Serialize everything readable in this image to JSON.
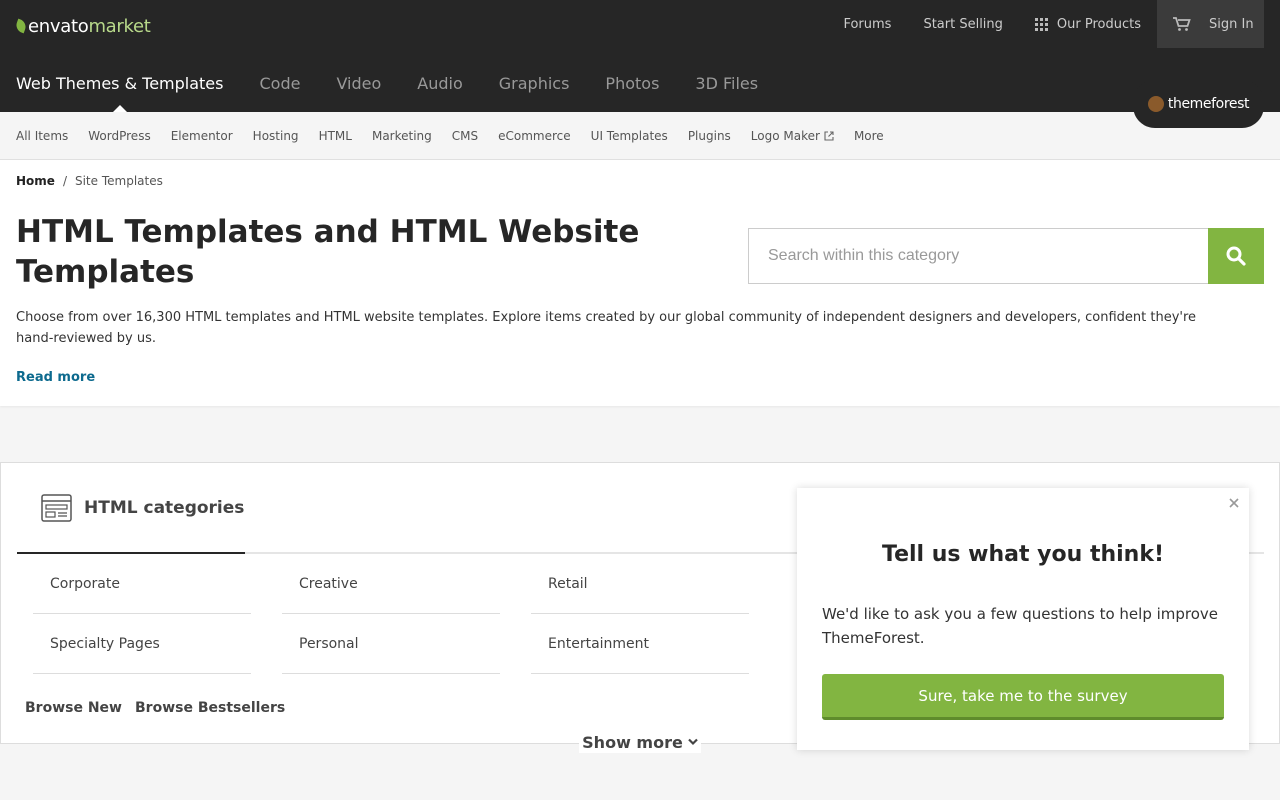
{
  "header": {
    "logo": {
      "text_main": "envato",
      "text_sub": "market"
    },
    "top_links": {
      "forums": "Forums",
      "start_selling": "Start Selling",
      "our_products": "Our Products",
      "sign_in": "Sign In"
    },
    "categories": [
      {
        "label": "Web Themes & Templates",
        "active": true
      },
      {
        "label": "Code"
      },
      {
        "label": "Video"
      },
      {
        "label": "Audio"
      },
      {
        "label": "Graphics"
      },
      {
        "label": "Photos"
      },
      {
        "label": "3D Files"
      }
    ],
    "badge": "themeforest"
  },
  "subnav": {
    "items": [
      "All Items",
      "WordPress",
      "Elementor",
      "Hosting",
      "HTML",
      "Marketing",
      "CMS",
      "eCommerce",
      "UI Templates",
      "Plugins",
      "Logo Maker",
      "More"
    ]
  },
  "hero": {
    "breadcrumb": {
      "home": "Home",
      "sep": "/",
      "current": "Site Templates"
    },
    "title": "HTML Templates and HTML Website Templates",
    "search": {
      "placeholder": "Search within this category"
    },
    "description": "Choose from over 16,300 HTML templates and HTML website templates. Explore items created by our global community of independent designers and developers, confident they're hand-reviewed by us.",
    "read_more": "Read more"
  },
  "categories_panel": {
    "title": "HTML categories",
    "row1": [
      "Corporate",
      "Creative",
      "Retail"
    ],
    "row2": [
      "Specialty Pages",
      "Personal",
      "Entertainment"
    ],
    "browse_new": "Browse New",
    "browse_bestsellers": "Browse Bestsellers",
    "show_more": "Show more"
  },
  "survey": {
    "title": "Tell us what you think!",
    "text": "We'd like to ask you a few questions to help improve ThemeForest.",
    "button": "Sure, take me to the survey"
  },
  "colors": {
    "accent": "#82b541",
    "dark": "#262626",
    "link": "#0d6a8e"
  }
}
